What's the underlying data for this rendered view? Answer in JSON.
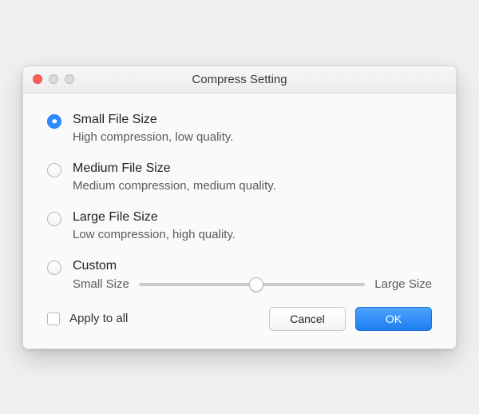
{
  "window": {
    "title": "Compress Setting"
  },
  "options": {
    "small": {
      "label": "Small File Size",
      "desc": "High compression, low quality.",
      "selected": true
    },
    "medium": {
      "label": "Medium File Size",
      "desc": "Medium compression, medium quality.",
      "selected": false
    },
    "large": {
      "label": "Large File Size",
      "desc": "Low compression, high quality.",
      "selected": false
    },
    "custom": {
      "label": "Custom",
      "slider_left_label": "Small Size",
      "slider_right_label": "Large Size",
      "selected": false
    }
  },
  "footer": {
    "apply_all_label": "Apply to all",
    "apply_all_checked": false,
    "cancel_label": "Cancel",
    "ok_label": "OK"
  }
}
